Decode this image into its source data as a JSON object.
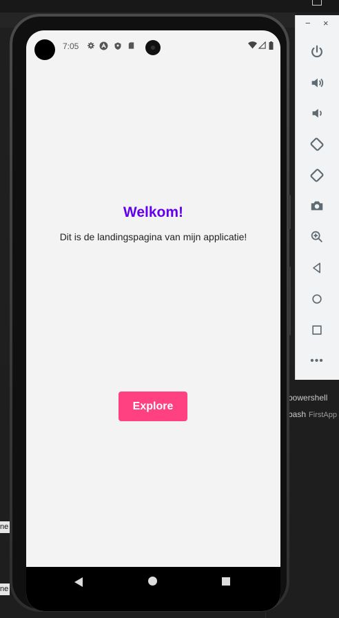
{
  "app": {
    "title": "Welkom!",
    "subtitle": "Dit is de landingspagina van mijn applicatie!",
    "button_label": "Explore"
  },
  "status_bar": {
    "time": "7:05",
    "icons": [
      "settings-icon",
      "sync-icon",
      "shield-icon",
      "sd-card-icon",
      "wifi-icon",
      "signal-icon",
      "battery-icon"
    ]
  },
  "nav_bar": {
    "icons": [
      "back-icon",
      "home-icon",
      "recents-icon"
    ]
  },
  "emulator_toolbar": {
    "window_controls": [
      "−",
      "×"
    ],
    "buttons": [
      "power-icon",
      "volume-up-icon",
      "volume-down-icon",
      "rotate-left-icon",
      "rotate-right-icon",
      "camera-icon",
      "zoom-icon",
      "back-icon",
      "home-icon",
      "overview-icon",
      "more-icon"
    ],
    "more_label": "•••"
  },
  "terminal_panel": {
    "items": [
      {
        "label": "powershell",
        "sub": ""
      },
      {
        "label": "bash",
        "sub": "FirstApp"
      }
    ]
  },
  "edge_labels": [
    "ne",
    "ne"
  ],
  "colors": {
    "accent": "#6200ee",
    "button": "#ff4081",
    "screen_bg": "#f3f3f3",
    "editor_bg": "#1f1f1f"
  }
}
